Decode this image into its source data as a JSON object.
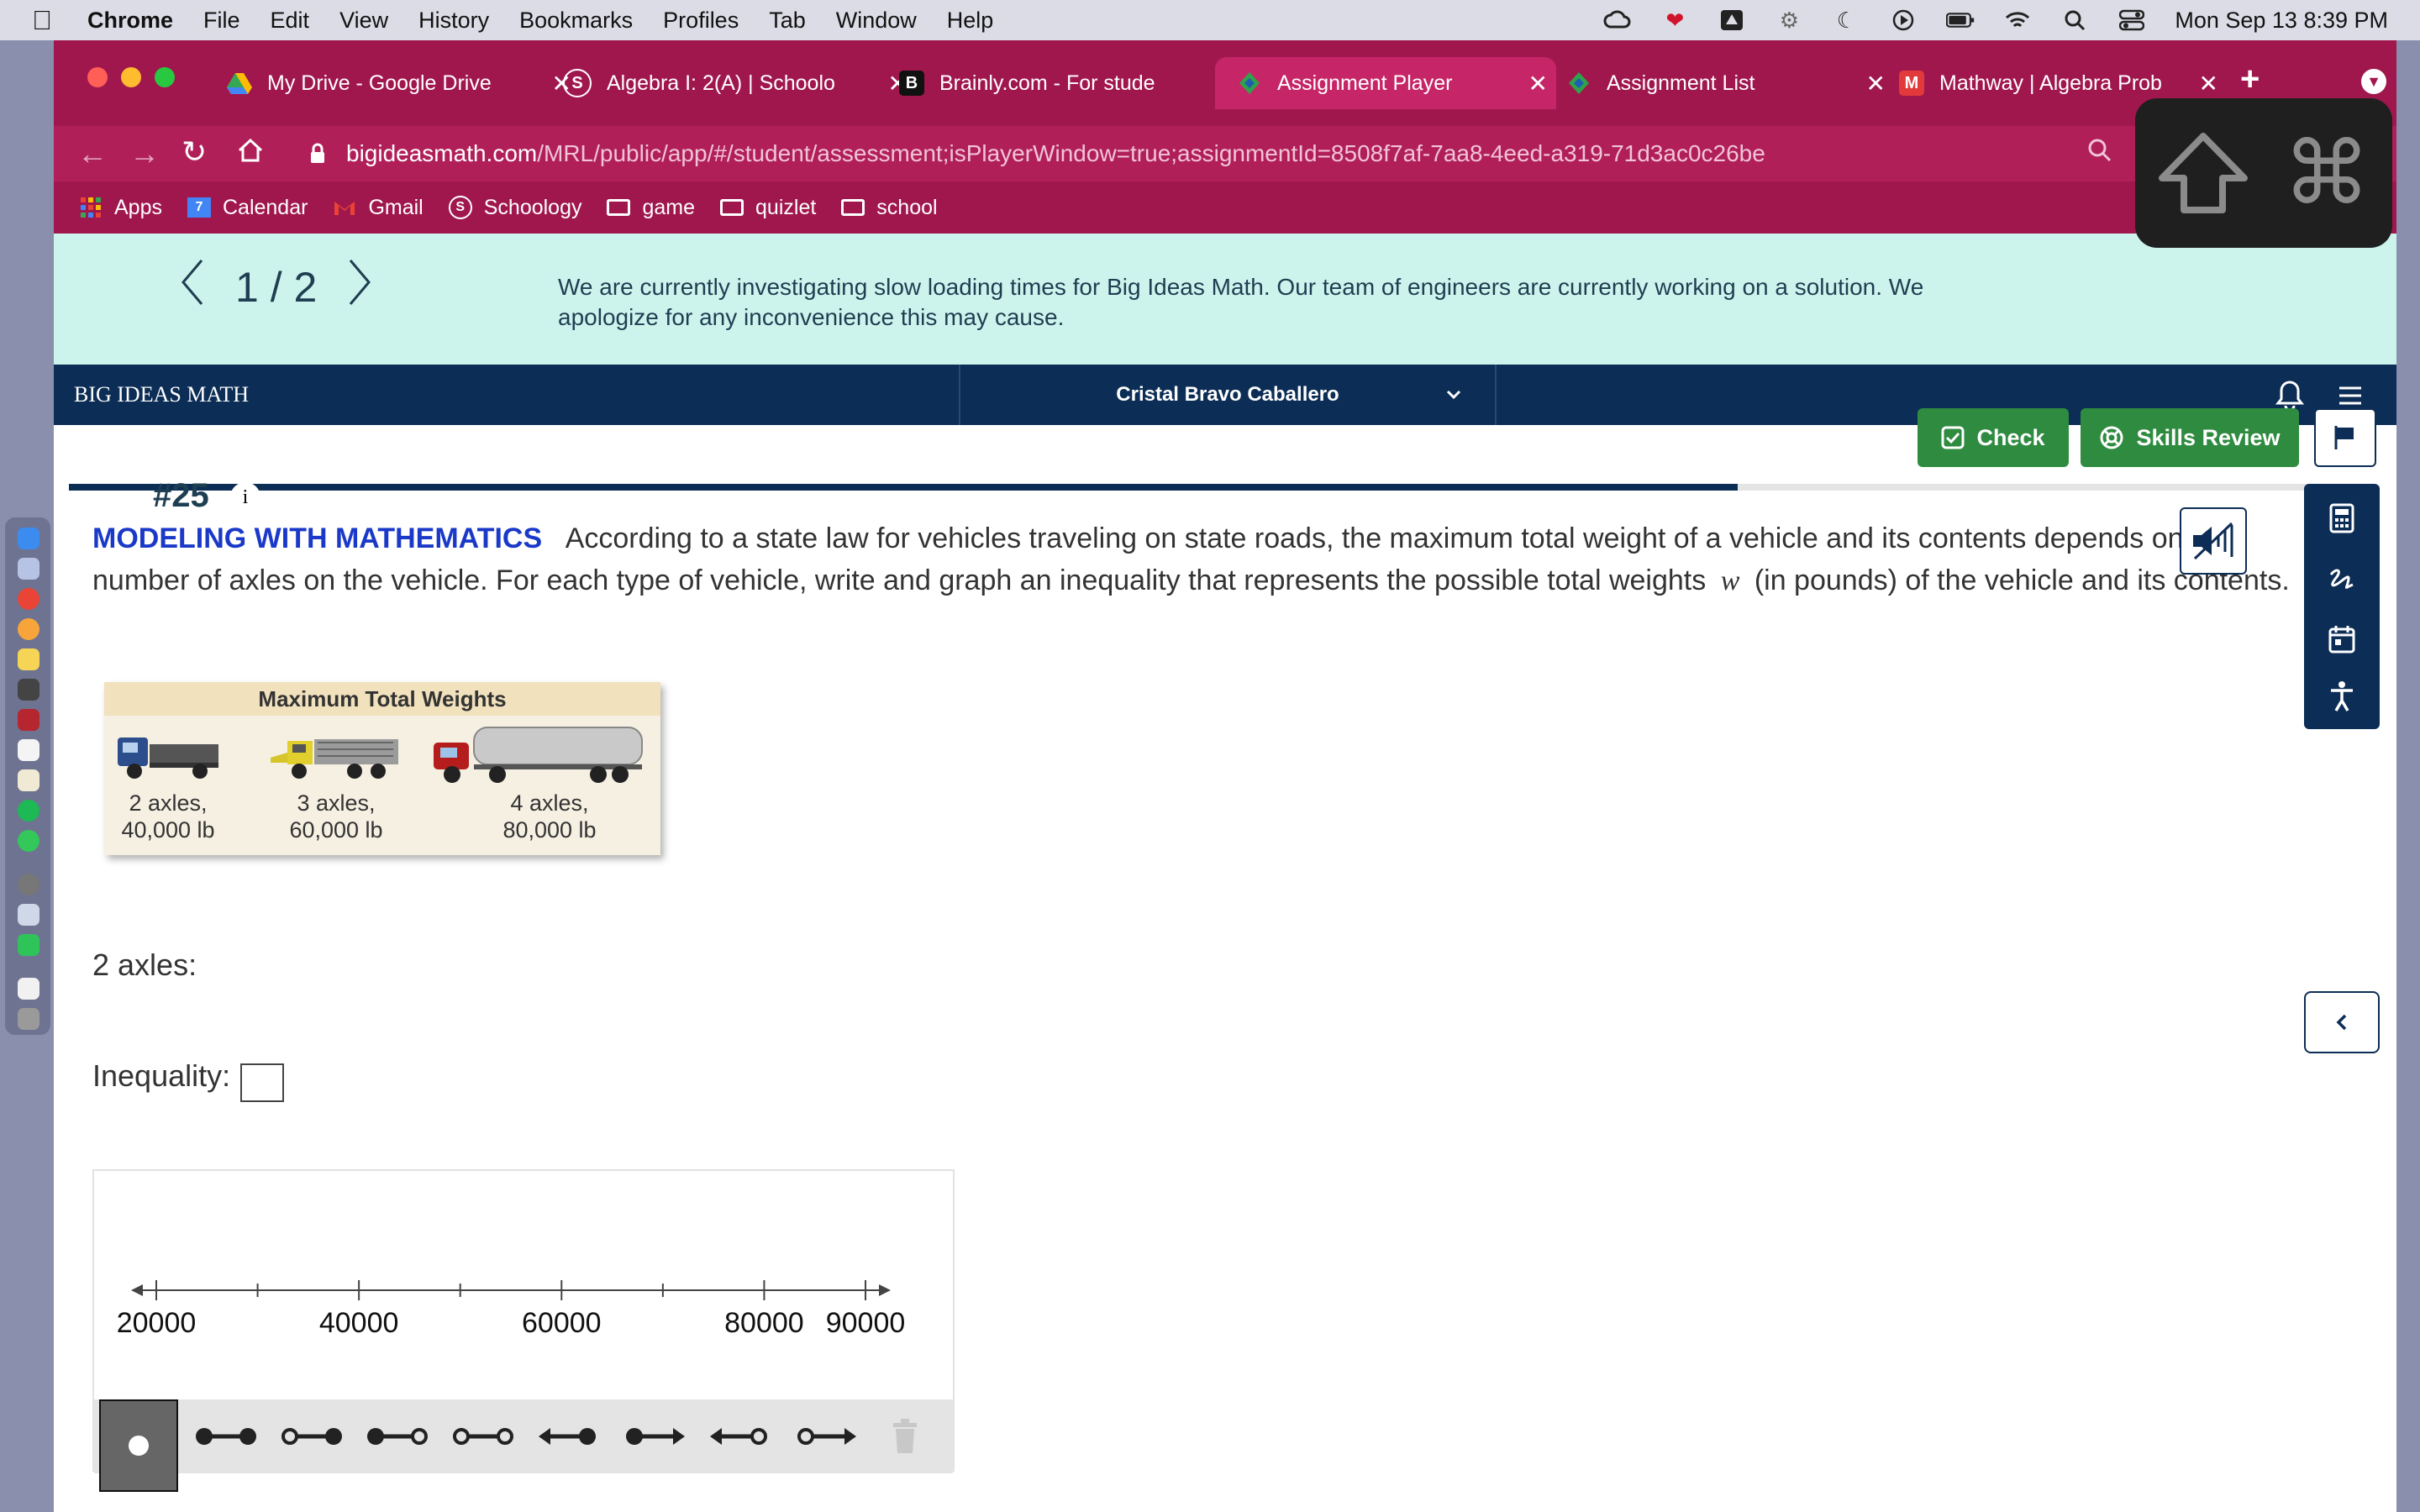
{
  "menubar": {
    "app": "Chrome",
    "items": [
      "File",
      "Edit",
      "View",
      "History",
      "Bookmarks",
      "Profiles",
      "Tab",
      "Window",
      "Help"
    ],
    "datetime": "Mon Sep 13  8:39 PM"
  },
  "tabs": [
    {
      "title": "My Drive - Google Drive",
      "favicon": "google-drive-icon"
    },
    {
      "title": "Algebra I: 2(A) | Schoolo",
      "favicon": "schoology-icon"
    },
    {
      "title": "Brainly.com - For stude",
      "favicon": "brainly-icon"
    },
    {
      "title": "Assignment Player",
      "favicon": "big-ideas-icon",
      "active": true
    },
    {
      "title": "Assignment List",
      "favicon": "big-ideas-icon"
    },
    {
      "title": "Mathway | Algebra Prob",
      "favicon": "mathway-icon"
    }
  ],
  "address_bar": {
    "domain": "bigideasmath.com",
    "path": "/MRL/public/app/#/student/assessment;isPlayerWindow=true;assignmentId=8508f7af-7aa8-4eed-a319-71d3ac0c26be"
  },
  "bookmarks": [
    "Apps",
    "Calendar",
    "Gmail",
    "Schoology",
    "game",
    "quizlet",
    "school"
  ],
  "banner": {
    "pager": "1 / 2",
    "message": "We are currently investigating slow loading times for Big Ideas Math. Our team of engineers are currently working on a solution. We apologize for any inconvenience this may cause."
  },
  "navbar": {
    "brand": "BIG IDEAS MATH",
    "user": "Cristal Bravo Caballero"
  },
  "actions": {
    "check": "Check",
    "skills_review": "Skills Review"
  },
  "progress": {
    "fraction": 0.73
  },
  "question": {
    "number": "#25",
    "info": "i",
    "heading": "MODELING WITH MATHEMATICS",
    "text_1": "According to a state law for vehicles traveling on state roads, the maximum total weight of a vehicle and its contents depends on the number of axles on the vehicle. For each type of vehicle, write and graph an inequality that represents the possible total weights",
    "variable": "w",
    "text_2": "(in pounds) of the vehicle and its contents."
  },
  "figure": {
    "title": "Maximum Total Weights",
    "vehicles": [
      {
        "line1": "2 axles,",
        "line2": "40,000 lb"
      },
      {
        "line1": "3 axles,",
        "line2": "60,000 lb"
      },
      {
        "line1": "4 axles,",
        "line2": "80,000 lb"
      }
    ]
  },
  "part": {
    "label": "2 axles:",
    "inequality_label": "Inequality:",
    "inequality_value": ""
  },
  "number_line": {
    "min": 20000,
    "max": 90000,
    "ticks": [
      20000,
      30000,
      40000,
      50000,
      60000,
      70000,
      80000,
      90000
    ],
    "labels": [
      "20000",
      "40000",
      "60000",
      "80000",
      "90000"
    ]
  },
  "graph_tools": [
    "point",
    "closed-closed-segment",
    "open-closed-segment",
    "closed-open-segment",
    "open-open-segment",
    "left-ray-closed",
    "right-ray-closed",
    "left-ray-open",
    "right-ray-open",
    "trash"
  ]
}
